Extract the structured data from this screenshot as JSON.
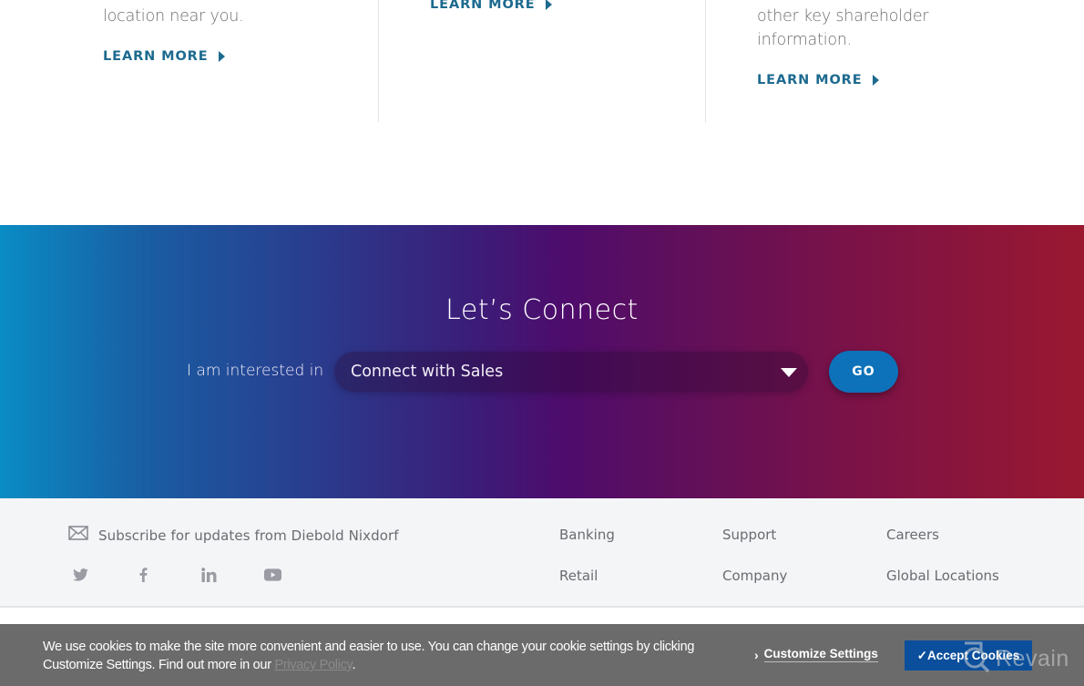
{
  "cards": [
    {
      "text_lines": [
        "location near you."
      ],
      "link_label": "LEARN MORE"
    },
    {
      "text_lines": [],
      "link_label": "LEARN MORE"
    },
    {
      "text_lines": [
        "other key shareholder",
        "information."
      ],
      "link_label": "LEARN MORE"
    }
  ],
  "connect": {
    "title": "Let’s Connect",
    "interest_label": "I am interested in",
    "select_value": "Connect with Sales",
    "go_label": "GO",
    "gradient_colors": [
      "#0a8cc4",
      "#2b3a8c",
      "#4e0c6c",
      "#7a1248",
      "#9a1830"
    ],
    "go_color": "#0d72b9"
  },
  "footer": {
    "subscribe_label": "Subscribe for updates from Diebold Nixdorf",
    "subscribe_icon": "envelope-icon",
    "social_icons": [
      "twitter-icon",
      "facebook-icon",
      "linkedin-icon",
      "youtube-icon"
    ],
    "links": [
      [
        "Banking",
        "Retail"
      ],
      [
        "Support",
        "Company"
      ],
      [
        "Careers",
        "Global Locations"
      ]
    ]
  },
  "cookie_bar": {
    "message_line1": "We use cookies to make the site more convenient and easier to use. You can change your cookie settings by clicking",
    "message_line2_prefix": "Customize Settings. Find out more in our ",
    "privacy_link": "Privacy Policy",
    "message_line2_suffix": ".",
    "customize_label": "Customize Settings",
    "accept_label": "✓Accept Cookies",
    "accept_color": "#0b4f9c"
  },
  "watermark": {
    "text": "Revain"
  }
}
